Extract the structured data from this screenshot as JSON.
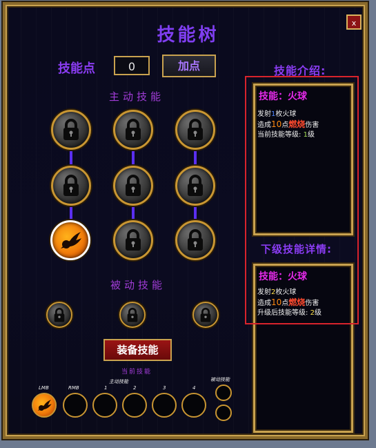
{
  "title": "技能树",
  "close_label": "x",
  "skill_points": {
    "label": "技能点",
    "value": "0",
    "add_button": "加点"
  },
  "active_section": "主动技能",
  "passive_section": "被动技能",
  "icons": {
    "locked": "lock-icon",
    "unlocked": "fireball-icon"
  },
  "colors": {
    "accent_purple": "#8a3cf2",
    "skill_name": "#e32ae8",
    "gold_border": "#c9a24f",
    "highlight": "#d8232c"
  },
  "info_panel": {
    "header": "技能介绍:",
    "title": "技能：火球",
    "line1": {
      "a": "发射",
      "b": "1",
      "c": "枚火球"
    },
    "line2": {
      "a": "造成",
      "b": "10",
      "c": "点",
      "d": "燃烧",
      "e": "伤害"
    },
    "line3": {
      "a": "当前技能等级:",
      "b": "1",
      "c": "级"
    }
  },
  "next_panel": {
    "header": "下级技能详情:",
    "title": "技能：火球",
    "line1": {
      "a": "发射",
      "b": "2",
      "c": "枚火球"
    },
    "line2": {
      "a": "造成",
      "b": "10",
      "c": "点",
      "d": "燃烧",
      "e": "伤害"
    },
    "line3": {
      "a": "升级后技能等级:",
      "b": "2",
      "c": "级"
    }
  },
  "equip_button": "装备技能",
  "current_skills_label": "当前技能",
  "slots": {
    "lmb": "LMB",
    "rmb": "RMB",
    "active_group": "主动技能",
    "s1": "1",
    "s2": "2",
    "s3": "3",
    "s4": "4",
    "passive_group": "被动技能"
  }
}
